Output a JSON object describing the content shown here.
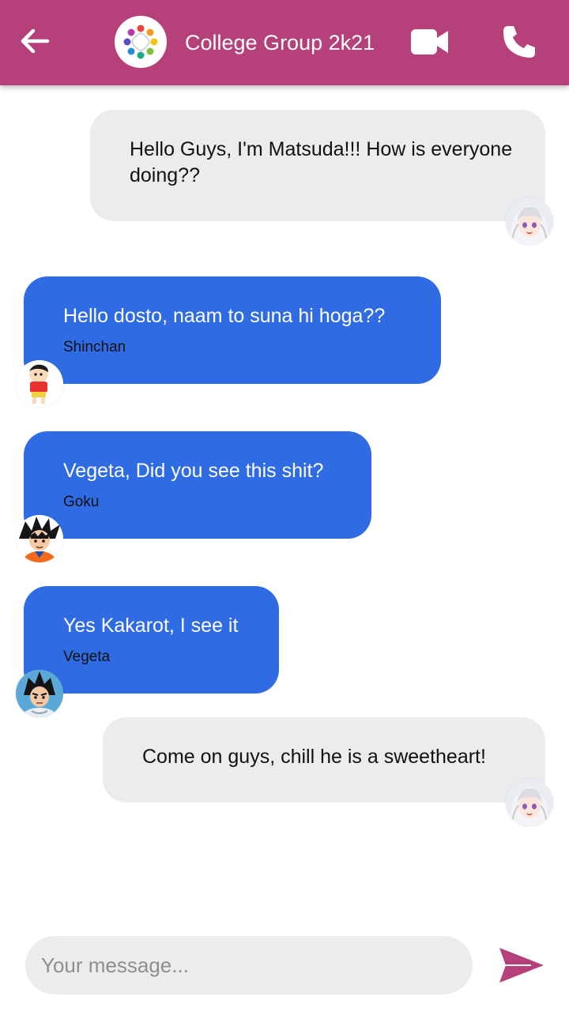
{
  "header": {
    "title": "College Group 2k21",
    "back_icon": "arrow-left-icon",
    "video_icon": "video-camera-icon",
    "call_icon": "phone-icon",
    "background": "#b5407a"
  },
  "messages": [
    {
      "direction": "outgoing",
      "text": "Hello Guys, I'm Matsuda!!! How is everyone doing??",
      "sender": "",
      "avatar": "white-haired-anime-girl-avatar"
    },
    {
      "direction": "incoming",
      "text": "Hello dosto, naam to suna hi hoga??",
      "sender": "Shinchan",
      "avatar": "shinchan-avatar"
    },
    {
      "direction": "incoming",
      "text": "Vegeta, Did you see this shit?",
      "sender": "Goku",
      "avatar": "goku-avatar"
    },
    {
      "direction": "incoming",
      "text": "Yes Kakarot, I see it",
      "sender": "Vegeta",
      "avatar": "vegeta-avatar"
    },
    {
      "direction": "outgoing",
      "text": "Come on guys, chill he is a sweetheart!",
      "sender": "",
      "avatar": "white-haired-anime-girl-avatar"
    }
  ],
  "composer": {
    "placeholder": "Your message...",
    "value": "",
    "send_icon": "send-arrow-icon"
  },
  "colors": {
    "accent": "#b5407a",
    "incoming_bubble": "#2f6be3",
    "outgoing_bubble": "#ececec"
  }
}
